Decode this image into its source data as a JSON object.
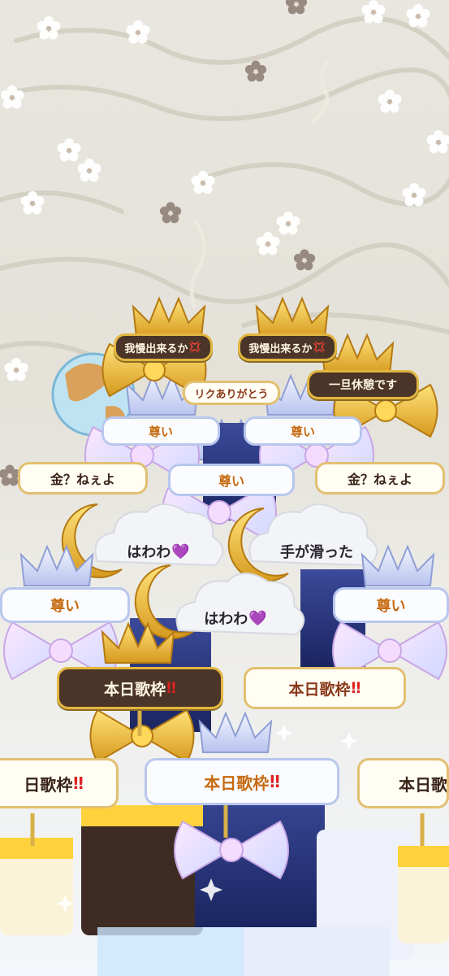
{
  "signs": {
    "gaman_1": "我慢出来るか",
    "gaman_2": "我慢出来るか",
    "arigato": "リクありがとう",
    "kyukei": "一旦休憩です",
    "toutoi_1": "尊い",
    "toutoi_2": "尊い",
    "toutoi_3": "尊い",
    "toutoi_4": "尊い",
    "toutoi_5": "尊い",
    "kane_1": "金？ねぇよ",
    "kane_2": "金？ねぇよ",
    "hawawa_1": "はわわ",
    "hawawa_2": "はわわ",
    "tegasubetta": "手が滑った",
    "utawaku_1": "本日歌枠",
    "utawaku_2": "本日歌枠",
    "utawaku_3": "本日歌枠",
    "utawaku_4": "日歌枠",
    "utawaku_5": "本日歌"
  },
  "marks": {
    "double_excl": "‼",
    "heart": "💜",
    "anger": "💢"
  },
  "colors": {
    "dark_sign": "#4a3528",
    "gold": "#e2b640",
    "blue_cake": "#2a3a7a"
  }
}
